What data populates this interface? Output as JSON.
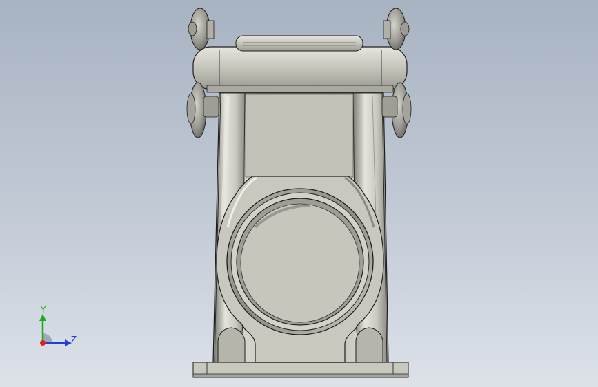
{
  "viewport": {
    "background_top": "#a8b3c2",
    "background_bottom": "#dde2e9",
    "model": {
      "part": "connector-hood-housing",
      "view": "front",
      "body_color": "#c6c6bc",
      "edge_color": "#1e1e1e"
    },
    "triad": {
      "y_label": "Y",
      "z_label": "Z",
      "x_color": "#e02020",
      "y_color": "#18b018",
      "z_color": "#1f3fd8"
    }
  }
}
